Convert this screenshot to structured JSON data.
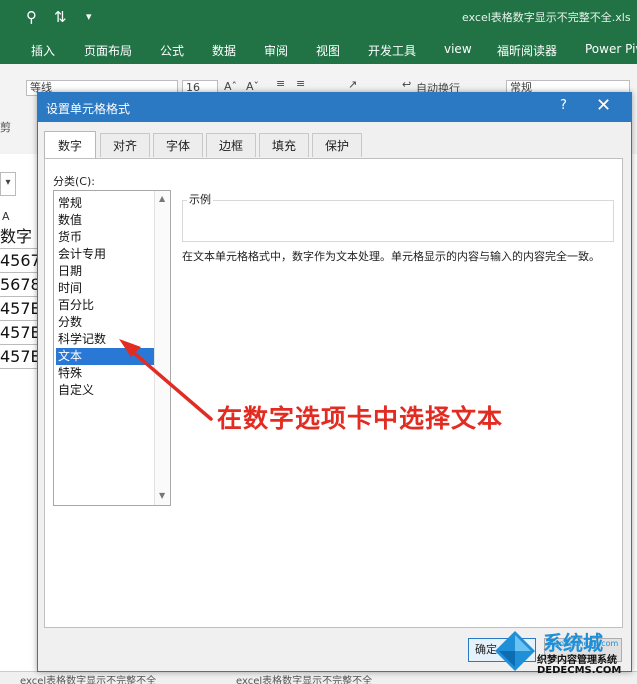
{
  "excel": {
    "doc_title": "excel表格数字显示不完整不全.xls",
    "menu": [
      "插入",
      "页面布局",
      "公式",
      "数据",
      "审阅",
      "视图",
      "开发工具",
      "view",
      "福昕阅读器",
      "Power Piv"
    ],
    "font_name": "等线",
    "font_size": "16",
    "auto_wrap": "自动换行",
    "number_format": "常规",
    "clipboard_label": "剪",
    "col_header": "A",
    "cells": [
      "数字",
      "4567",
      "5678",
      "457E",
      "457E",
      "457E"
    ],
    "sheet_tabs": [
      "excel表格数字显示不完整不全",
      "excel表格数字显示不完整不全"
    ]
  },
  "dialog": {
    "title": "设置单元格格式",
    "help": "?",
    "close": "✕",
    "tabs": [
      "数字",
      "对齐",
      "字体",
      "边框",
      "填充",
      "保护"
    ],
    "category_label": "分类(C):",
    "categories": [
      "常规",
      "数值",
      "货币",
      "会计专用",
      "日期",
      "时间",
      "百分比",
      "分数",
      "科学记数",
      "文本",
      "特殊",
      "自定义"
    ],
    "selected_category": "文本",
    "sample_label": "示例",
    "description": "在文本单元格格式中，数字作为文本处理。单元格显示的内容与输入的内容完全一致。",
    "ok_label": "确定"
  },
  "annotation": "在数字选项卡中选择文本",
  "watermark": {
    "logo": "系统城",
    "site_cn": "织梦内容管理系统",
    "site": "DEDECMS.COM",
    "sub": "xitongcheng.com"
  },
  "colors": {
    "excel_green": "#217346",
    "dialog_blue": "#2b79c2",
    "selection_blue": "#2a78d6",
    "annotation_red": "#e22b21"
  }
}
